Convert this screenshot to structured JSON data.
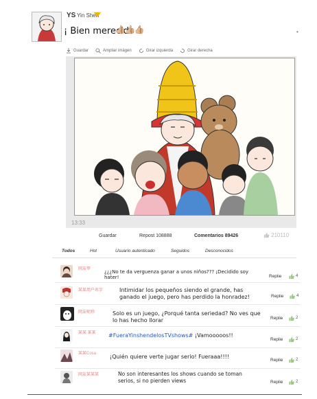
{
  "post": {
    "author_prefix": "YS",
    "author_name": "Yin Shen",
    "title": "¡ Bien merecido !",
    "title_emojis": "👍🏼👍🏼👍🏼",
    "dot": "•",
    "timestamp": "13:33"
  },
  "toolbar": {
    "items": [
      "Guardar",
      "Ampliar imágen",
      "Girar izquierda",
      "Girar derecha"
    ]
  },
  "stats": {
    "save": "Guardar",
    "repost": "Repost 108888",
    "comments": "Comentarios 89426",
    "likes": "210110"
  },
  "tabs": [
    "Todos",
    "Hot",
    "Usuario autenticado",
    "Seguidos",
    "Desconocidos"
  ],
  "comments": [
    {
      "user": "网友甲",
      "text": "¿¿¿No te da verguenza ganar a unos niños??? ¡Decidido soy hater!",
      "reply": "Replie",
      "count": "4"
    },
    {
      "user": "某某用户名字",
      "text": "Intimidar los pequeños siendo el grande, has ganado el juego, pero has perdido la honradez!",
      "reply": "Replie",
      "count": "4"
    },
    {
      "user": "网友昵称",
      "text": "Solo es un juego, ¿Porqué tanta seriedad? No ves que lo has hecho llorar",
      "reply": "Replie",
      "count": "2"
    },
    {
      "user": "某某 某某",
      "hashtag": "#FueraYinshendelosTVshows#",
      "text": " ¡Vamooooos!!",
      "reply": "Replie",
      "count": "2"
    },
    {
      "user": "某某Cosa",
      "text": "¡Quién quiere verte jugar serio! Fueraaa!!!!",
      "reply": "Replie",
      "count": "2"
    },
    {
      "user": "网友某某某",
      "text": "No son interesantes los shows cuando se toman serios, si no pierden views",
      "reply": "Replie",
      "count": "2"
    }
  ],
  "colors": {
    "hashtag": "#2255cc",
    "username": "#dd5555",
    "panel": "#e9e9e9"
  }
}
